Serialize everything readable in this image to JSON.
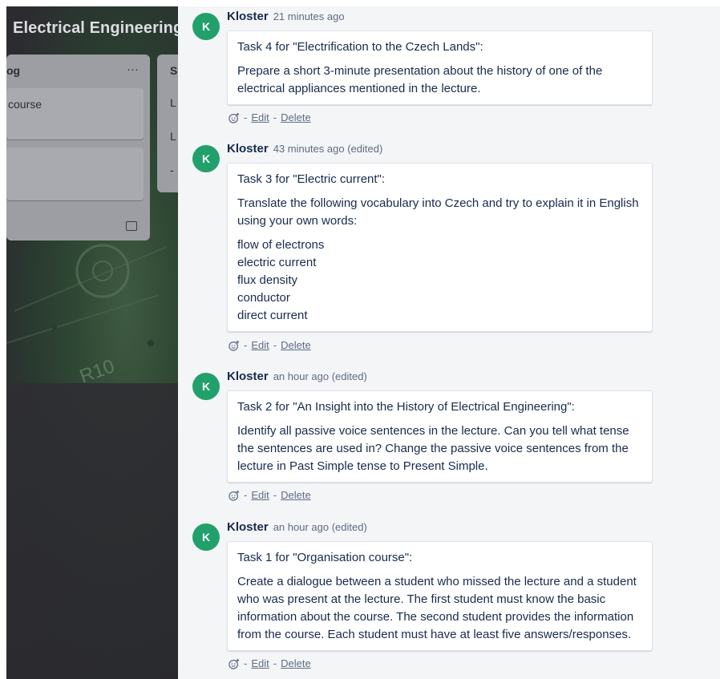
{
  "board": {
    "title": "Electrical Engineering",
    "list1": {
      "header": "og",
      "more": "···",
      "card1": "course"
    },
    "list2": {
      "header": "S",
      "row1": "L",
      "row2": "L",
      "row3": "-"
    }
  },
  "comments": [
    {
      "avatar": "K",
      "author": "Kloster",
      "time": "21 minutes ago",
      "lines": [
        "Task 4 for \"Electrification to the Czech Lands\":",
        "Prepare a short 3-minute presentation about the history of one of the electrical appliances mentioned in the lecture."
      ],
      "edit": "Edit",
      "delete": "Delete"
    },
    {
      "avatar": "K",
      "author": "Kloster",
      "time": "43 minutes ago (edited)",
      "lines": [
        "Task 3 for \"Electric current\":",
        "Translate the following vocabulary into Czech and try to explain it in English using your own words:"
      ],
      "vocab": [
        "flow of electrons",
        "electric current",
        "flux density",
        "conductor",
        "direct current"
      ],
      "edit": "Edit",
      "delete": "Delete"
    },
    {
      "avatar": "K",
      "author": "Kloster",
      "time": "an hour ago (edited)",
      "lines": [
        "Task 2 for \"An Insight into the History of Electrical Engineering\":",
        "Identify all passive voice sentences in the lecture. Can you tell what tense the sentences are used in? Change the passive voice sentences from the lecture in Past Simple tense to Present Simple."
      ],
      "edit": "Edit",
      "delete": "Delete"
    },
    {
      "avatar": "K",
      "author": "Kloster",
      "time": "an hour ago (edited)",
      "lines": [
        "Task 1 for \"Organisation course\":",
        "Create a dialogue between a student who missed the lecture and a student who was present at the lecture. The first student must know the basic information about the course. The second student provides the information from the course. Each student must have at least five answers/responses."
      ],
      "edit": "Edit",
      "delete": "Delete"
    }
  ],
  "separator": "-",
  "colors": {
    "avatar": "#22a06b",
    "panel": "#f4f5f7",
    "text": "#172b4d"
  },
  "icons": {
    "reaction": "add-reaction-icon",
    "copy": "copy-icon"
  }
}
